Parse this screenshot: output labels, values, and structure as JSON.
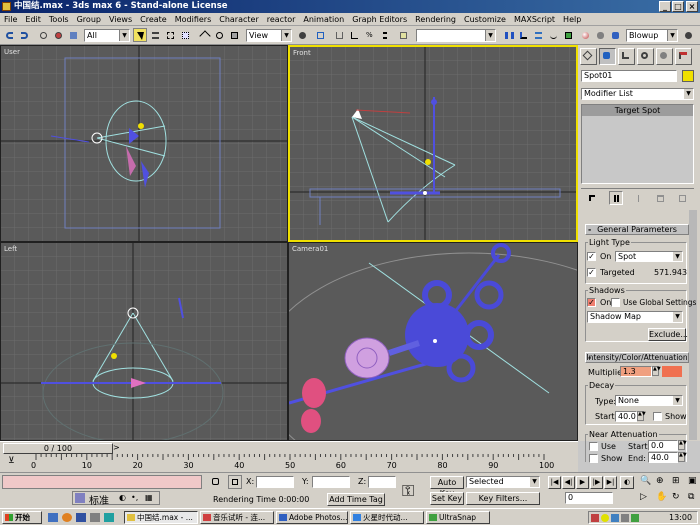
{
  "window": {
    "title": "中国结.max - 3ds max 6 - Stand-alone License"
  },
  "menu": [
    "File",
    "Edit",
    "Tools",
    "Group",
    "Views",
    "Create",
    "Modifiers",
    "Character",
    "reactor",
    "Animation",
    "Graph Editors",
    "Rendering",
    "Customize",
    "MAXScript",
    "Help"
  ],
  "toolbar": {
    "selection_filter": "All",
    "ref_coord": "View",
    "named_selection": "",
    "render_type": "Blowup"
  },
  "viewports": {
    "top_left": "User",
    "top_right": "Front",
    "bottom_left": "Left",
    "bottom_right": "Camera01"
  },
  "command_panel": {
    "object_name": "Spot01",
    "modifier_list": "Modifier List",
    "stack_item": "Target Spot",
    "general_parameters": {
      "title": "General Parameters",
      "light_type_label": "Light Type",
      "on_label": "On",
      "light_type_value": "Spot",
      "targeted_label": "Targeted",
      "targeted_distance": "571.943",
      "shadows_label": "Shadows",
      "shadows_on_label": "On",
      "use_global_label": "Use Global Settings",
      "shadow_type": "Shadow Map",
      "exclude_label": "Exclude..."
    },
    "intensity": {
      "title": "Intensity/Color/Attenuation",
      "multiplier_label": "Multiplier:",
      "multiplier_value": "1.3",
      "decay_label": "Decay",
      "type_label": "Type:",
      "type_value": "None",
      "start_label": "Start:",
      "start_value": "40.0",
      "show_label": "Show",
      "near_label": "Near Attenuation",
      "use_label": "Use",
      "near_start_label": "Start:",
      "near_start_value": "0.0",
      "near_show_label": "Show",
      "end_label": "End:",
      "end_value": "40.0"
    },
    "accent": "#f0e000"
  },
  "timeline": {
    "slider_label": "0 / 100",
    "ticks": [
      "0",
      "10",
      "20",
      "30",
      "40",
      "50",
      "60",
      "70",
      "80",
      "90",
      "100"
    ]
  },
  "status": {
    "x_label": "X:",
    "y_label": "Y:",
    "z_label": "Z:",
    "rendering_time": "Rendering Time  0:00:00",
    "add_time_tag": "Add Time Tag",
    "auto_key": "Auto Key",
    "auto_key_value": "Selected",
    "set_key": "Set Key",
    "key_filters": "Key Filters...",
    "frame": "0",
    "ime_label": "标准"
  },
  "taskbar": {
    "start": "开始",
    "tasks": [
      "中国结.max - ...",
      "音乐试听 - 连...",
      "Adobe Photos...",
      "火星时代动...",
      "UltraSnap"
    ],
    "clock": "13:00"
  }
}
